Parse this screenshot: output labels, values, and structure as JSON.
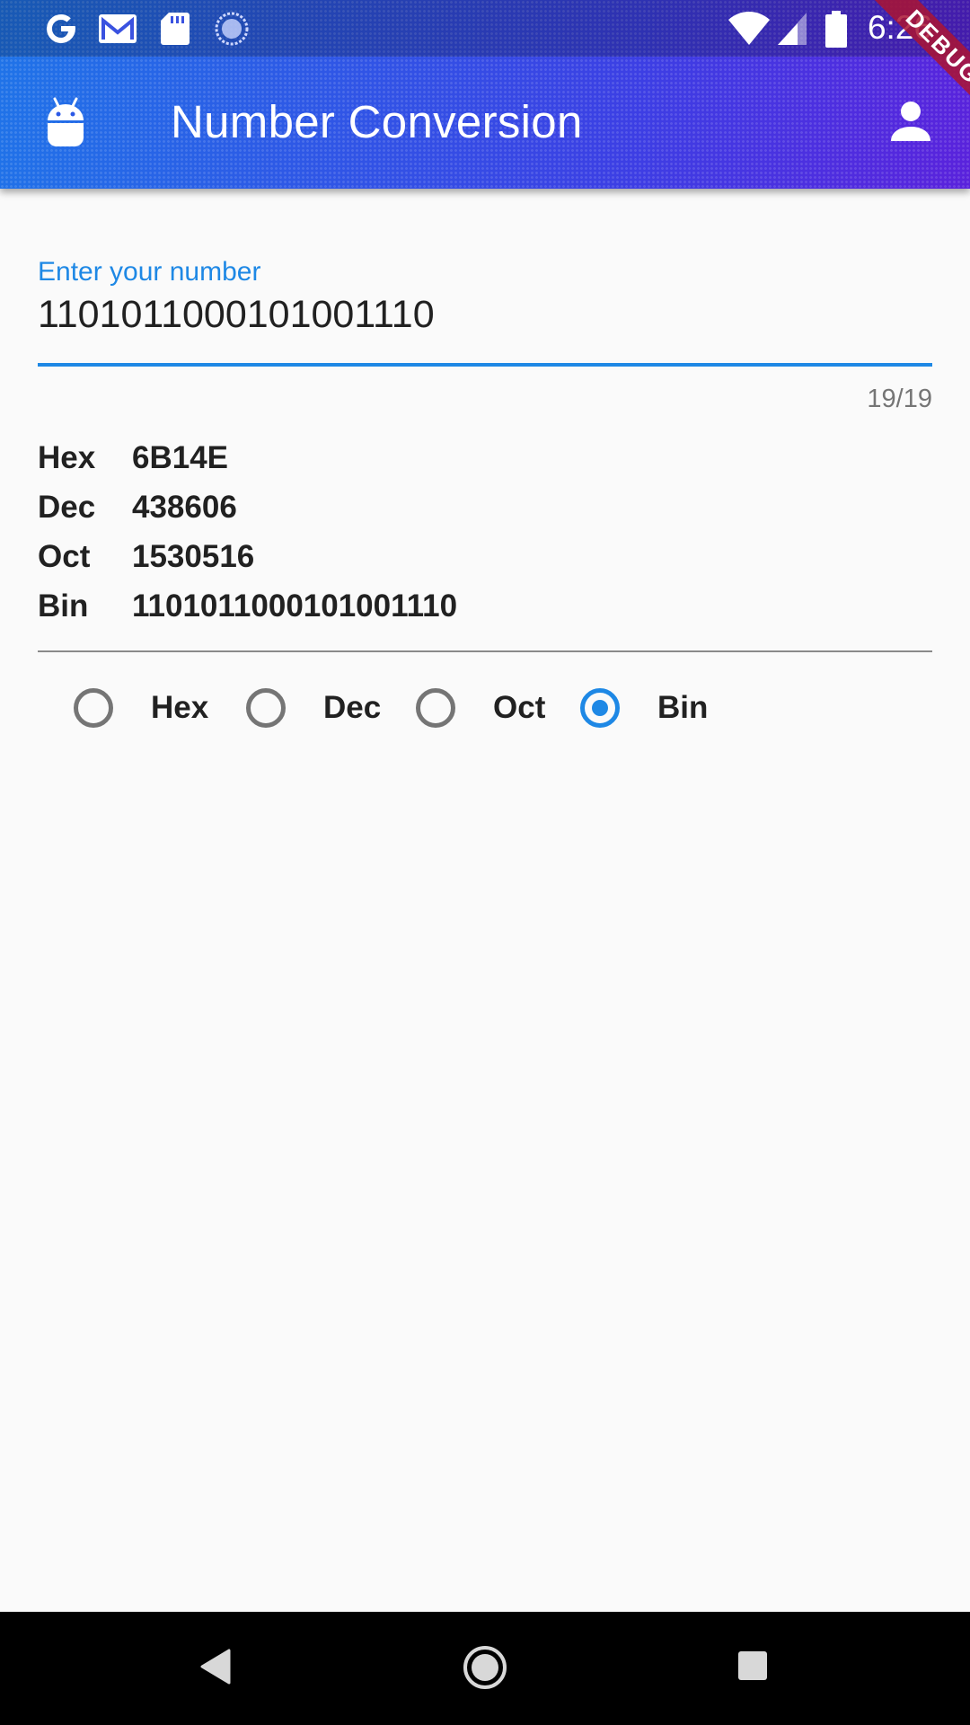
{
  "status_bar": {
    "time": "6:26",
    "left_icons": [
      "google-icon",
      "gmail-icon",
      "sd-card-icon",
      "sync-circle-icon"
    ],
    "right_icons": [
      "wifi-icon",
      "signal-icon",
      "battery-icon"
    ]
  },
  "app_bar": {
    "title": "Number Conversion",
    "leading_icon": "android-icon",
    "trailing_icon": "account-icon",
    "debug_banner": "DEBUG",
    "gradient_colors": [
      "#1f74e8",
      "#5a22dc"
    ]
  },
  "input": {
    "label": "Enter your number",
    "value": "1101011000101001110",
    "counter": "19/19",
    "accent_color": "#1e88e5"
  },
  "results": [
    {
      "key": "Hex",
      "value": "6B14E"
    },
    {
      "key": "Dec",
      "value": "438606"
    },
    {
      "key": "Oct",
      "value": "1530516"
    },
    {
      "key": "Bin",
      "value": "1101011000101001110"
    }
  ],
  "radio_group": {
    "options": [
      {
        "label": "Hex",
        "checked": false
      },
      {
        "label": "Dec",
        "checked": false
      },
      {
        "label": "Oct",
        "checked": false
      },
      {
        "label": "Bin",
        "checked": true
      }
    ],
    "selected": "Bin"
  },
  "nav_bar": {
    "buttons": [
      "back-icon",
      "home-icon",
      "recents-icon"
    ]
  }
}
